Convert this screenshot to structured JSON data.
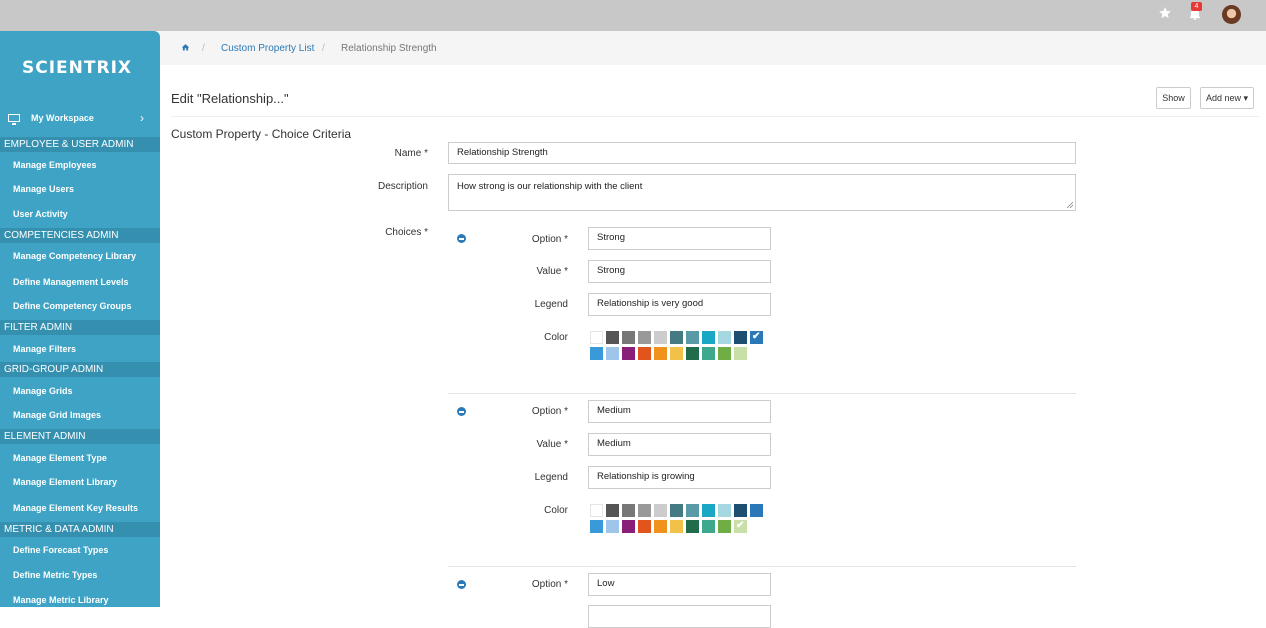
{
  "topbar": {
    "notification_count": "4",
    "icons": [
      "star-icon",
      "bell-icon",
      "avatar"
    ]
  },
  "sidebar": {
    "logo": "SCIENTRIX",
    "workspace": "My Workspace",
    "sections": [
      {
        "title": "EMPLOYEE & USER ADMIN",
        "items": [
          "Manage Employees",
          "Manage Users",
          "User Activity"
        ]
      },
      {
        "title": "COMPETENCIES ADMIN",
        "items": [
          "Manage Competency Library",
          "Define Management Levels",
          "Define Competency Groups"
        ]
      },
      {
        "title": "FILTER ADMIN",
        "items": [
          "Manage Filters"
        ]
      },
      {
        "title": "GRID-GROUP ADMIN",
        "items": [
          "Manage Grids",
          "Manage Grid Images"
        ]
      },
      {
        "title": "ELEMENT ADMIN",
        "items": [
          "Manage Element Type",
          "Manage Element Library",
          "Manage Element Key Results"
        ]
      },
      {
        "title": "METRIC & DATA ADMIN",
        "items": [
          "Define Forecast Types",
          "Define Metric Types",
          "Manage Metric Library"
        ]
      }
    ]
  },
  "breadcrumb": {
    "link": "Custom Property List",
    "sep": "/",
    "current": "Relationship Strength"
  },
  "page": {
    "title": "Edit \"Relationship...\"",
    "show_label": "Show",
    "add_new_label": "Add new ▾"
  },
  "form": {
    "section_title": "Custom Property - Choice Criteria",
    "name_label": "Name *",
    "name_value": "Relationship Strength",
    "description_label": "Description",
    "description_value": "How strong is our relationship with the client",
    "choices_label": "Choices *",
    "option_label": "Option *",
    "value_label": "Value *",
    "legend_label": "Legend",
    "color_label": "Color",
    "choices": [
      {
        "option": "Strong",
        "value": "Strong",
        "legend": "Relationship is very good",
        "selected_color_index": 10
      },
      {
        "option": "Medium",
        "value": "Medium",
        "legend": "Relationship is growing",
        "selected_color_index": 20
      },
      {
        "option": "Low"
      }
    ]
  },
  "palette": [
    "#ffffff",
    "#555555",
    "#777777",
    "#999999",
    "#cccccc",
    "#457a85",
    "#5a9aa6",
    "#1aa7c6",
    "#a5d8e1",
    "#1e4f72",
    "#2a78b8",
    "#3a9ad9",
    "#9fc5ea",
    "#8a1f7a",
    "#e1541b",
    "#f0931e",
    "#f2c14a",
    "#216d4b",
    "#3da88c",
    "#6fae45",
    "#c8e0a8"
  ]
}
